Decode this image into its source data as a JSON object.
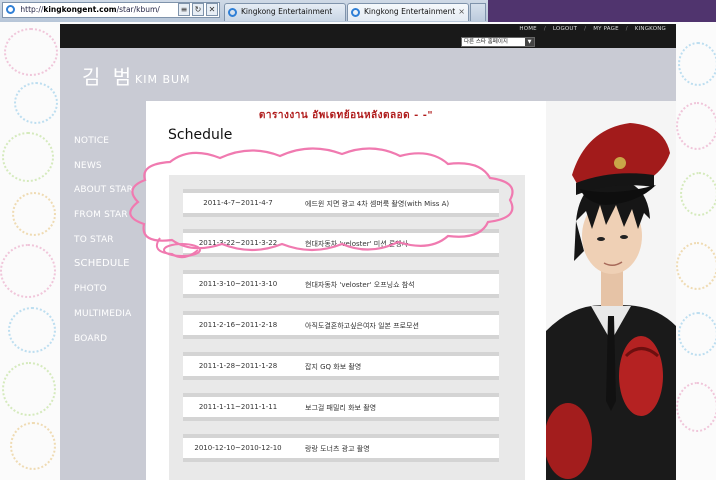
{
  "browser": {
    "url_prefix": "http://",
    "url_domain": "kingkongent.com",
    "url_path": "/star/kbum/",
    "tabs": [
      {
        "label": "Kingkong Entertainment",
        "active": false
      },
      {
        "label": "Kingkong Entertainment",
        "active": true
      }
    ],
    "close_glyph": "×",
    "back_glyph": "≡",
    "refresh_glyph": "↻",
    "stop_glyph": "✕"
  },
  "site": {
    "top_nav": [
      "HOME",
      "LOGOUT",
      "MY PAGE",
      "KINGKONG"
    ],
    "fan_select": "다른 스타 홈페이지",
    "logo_korean": "김 범",
    "logo_english": "KIM BUM",
    "menu": [
      {
        "label": "NOTICE"
      },
      {
        "label": "NEWS"
      },
      {
        "label": "ABOUT STAR"
      },
      {
        "label": "FROM STAR"
      },
      {
        "label": "TO STAR"
      },
      {
        "label": "SCHEDULE",
        "active": true
      },
      {
        "label": "PHOTO"
      },
      {
        "label": "MULTIMEDIA"
      },
      {
        "label": "BOARD"
      }
    ],
    "notice_banner": "ตารางงาน   อัพเดทย้อนหลังตลอด - -\"",
    "schedule_title": "Schedule",
    "schedule": [
      {
        "date": "2011-4-7~2011-4-7",
        "title": "에드윈 지면 광고 4차 셈머룩 촬영(with Miss A)"
      },
      {
        "date": "2011-3-22~2011-3-22",
        "title": "현대자동차 'veloster' 미션 론행사"
      },
      {
        "date": "2011-3-10~2011-3-10",
        "title": "현대자동차 'veloster' 오프닝쇼 참석"
      },
      {
        "date": "2011-2-16~2011-2-18",
        "title": "아직도결혼하고싶은여자 일본 프로모션"
      },
      {
        "date": "2011-1-28~2011-1-28",
        "title": "잡지 GQ 화보 촬영"
      },
      {
        "date": "2011-1-11~2011-1-11",
        "title": "보그걸 패밀리 화보 촬영"
      },
      {
        "date": "2010-12-10~2010-12-10",
        "title": "랑랑 도너츠 광고 촬영"
      }
    ]
  },
  "colors": {
    "site_bg": "#c9cbd4",
    "topbar": "#191919",
    "notice_red": "#b01c1c",
    "cloud_pink": "#f07ab0",
    "chrome_purple": "#50346e"
  }
}
